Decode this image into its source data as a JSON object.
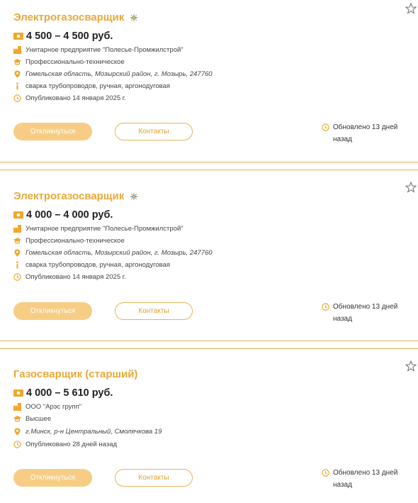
{
  "listings": [
    {
      "title": "Электрогазосварщик",
      "featured": true,
      "salary": "4 500 – 4 500 руб.",
      "company": "Унитарное предприятие \"Полесье-Промжилстрой\"",
      "education": "Профессионально-техническое",
      "location": "Гомельская область, Мозырский район, г. Мозырь, 247760",
      "skills": "сварка трубопроводов, ручная, аргонодуговая",
      "published": "Опубликовано 14 января 2025 г.",
      "respond_label": "Откликнуться",
      "contacts_label": "Контакты",
      "updated_line1": "Обновлено 13 дней",
      "updated_line2": "назад"
    },
    {
      "title": "Электрогазосварщик",
      "featured": true,
      "salary": "4 000 – 4 000 руб.",
      "company": "Унитарное предприятие \"Полесье-Промжилстрой\"",
      "education": "Профессионально-техническое",
      "location": "Гомельская область, Мозырский район, г. Мозырь, 247760",
      "skills": "сварка трубопроводов, ручная, аргонодуговая",
      "published": "Опубликовано 14 января 2025 г.",
      "respond_label": "Откликнуться",
      "contacts_label": "Контакты",
      "updated_line1": "Обновлено 13 дней",
      "updated_line2": "назад"
    },
    {
      "title": "Газосварщик (старший)",
      "featured": false,
      "salary": "4 000 – 5 610 руб.",
      "company": "ООО \"Арэс групп\"",
      "education": "Высшее",
      "location": "г.Минск, р-н Центральный, Смолячкова 19",
      "published": "Опубликовано 28 дней назад",
      "respond_label": "Откликнуться",
      "contacts_label": "Контакты",
      "updated_line1": "Обновлено 13 дней",
      "updated_line2": "назад"
    }
  ],
  "colors": {
    "accent": "#e8a93a",
    "button_fill": "#f7cd85",
    "divider": "#e9b649"
  },
  "icons": [
    "spark-icon",
    "star-icon",
    "money-icon",
    "company-icon",
    "education-icon",
    "location-icon",
    "info-icon",
    "clock-icon"
  ]
}
